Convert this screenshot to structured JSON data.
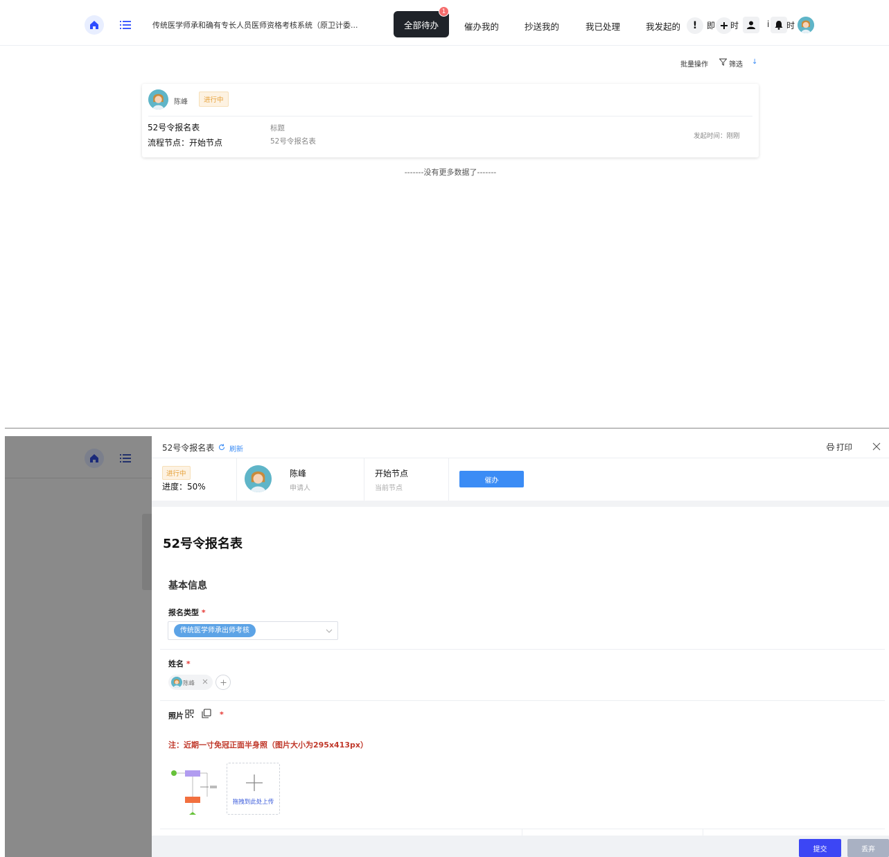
{
  "nav": {
    "app_title": "传统医学师承和确有专长人员医师资格考核系统（原卫计委...",
    "tabs": [
      {
        "label": "全部待办",
        "active": true,
        "badge": "1"
      },
      {
        "label": "催办我的"
      },
      {
        "label": "抄送我的"
      },
      {
        "label": "我已处理"
      },
      {
        "label": "我发起的"
      }
    ],
    "right_fragments": [
      "即",
      "时",
      "i",
      "时"
    ],
    "icons": [
      "home-icon",
      "menu-list-icon",
      "exclamation-icon",
      "plus-icon",
      "user-icon",
      "bell-icon",
      "avatar"
    ]
  },
  "list": {
    "toolbar": {
      "batch": "批量操作",
      "filter": "筛选",
      "sort_symbol": "↓"
    },
    "card": {
      "applicant": "陈峰",
      "status": "进行中",
      "form_name": "52号令报名表",
      "node": "流程节点：开始节点",
      "title_label": "标题",
      "title_value": "52号令报名表",
      "time": "发起时间：刚刚"
    },
    "no_more": "-------没有更多数据了-------"
  },
  "drawer": {
    "title": "52号令报名表",
    "refresh": "刷新",
    "print": "打印",
    "status": "进行中",
    "progress": "进度：50%",
    "applicant_name": "陈峰",
    "applicant_label": "申请人",
    "node_name": "开始节点",
    "node_label": "当前节点",
    "urge_button": "催办",
    "form": {
      "heading": "52号令报名表",
      "section": "基本信息",
      "type_label": "报名类型",
      "type_value": "传统医学师承出师考核",
      "name_label": "姓名",
      "name_value": "陈峰",
      "photo_label": "照片",
      "note": "注：近期一寸免冠正面半身照（图片大小为295x413px）",
      "upload_text": "拖拽到此处上传"
    },
    "footer": {
      "submit": "提交",
      "discard": "丢弃"
    }
  },
  "colors": {
    "active_tab": "#1f2329",
    "primary": "#3c46f5",
    "urge_button": "#3b8cf5",
    "status_orange": "#e6a23c",
    "note_red": "#c0392b",
    "badge_red": "#f56c6c",
    "overlay_gray": "#8a8a8a"
  }
}
